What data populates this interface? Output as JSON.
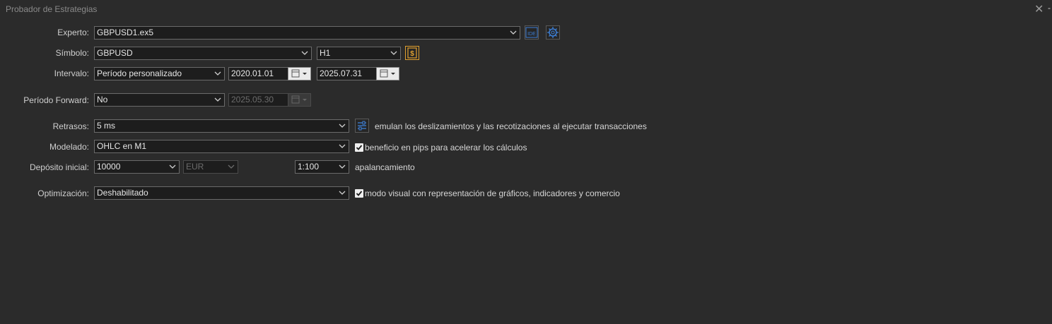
{
  "window": {
    "title": "Probador de Estrategias",
    "right_mark": "-"
  },
  "labels": {
    "experto": "Experto:",
    "simbolo": "Símbolo:",
    "intervalo": "Intervalo:",
    "periodo_forward": "Período Forward:",
    "retrasos": "Retrasos:",
    "modelado": "Modelado:",
    "deposito": "Depósito inicial:",
    "optimizacion": "Optimización:"
  },
  "fields": {
    "experto": "GBPUSD1.ex5",
    "simbolo": "GBPUSD",
    "timeframe": "H1",
    "intervalo": "Período personalizado",
    "fecha_inicio": "2020.01.01",
    "fecha_fin": "2025.07.31",
    "forward": "No",
    "fecha_forward": "2025.05.30",
    "retrasos": "5 ms",
    "modelado": "OHLC en M1",
    "deposito": "10000",
    "moneda": "EUR",
    "apalancamiento": "1:100",
    "optimizacion": "Deshabilitado"
  },
  "buttons": {
    "ide": "IDE"
  },
  "notes": {
    "retrasos": "emulan los deslizamientos y las recotizaciones al ejecutar transacciones",
    "modelado": "beneficio en pips para acelerar los cálculos",
    "apalancamiento": "apalancamiento",
    "optimizacion": "modo visual con representación de gráficos, indicadores y comercio"
  },
  "checkboxes": {
    "pips": true,
    "visual": true
  },
  "icons": {
    "close": "close-icon",
    "dropdown": "chevron-down-icon",
    "calendar": "calendar-icon",
    "ide": "ide-icon",
    "settings": "gear-icon",
    "dollar": "dollar-icon",
    "sliders": "sliders-icon"
  },
  "colors": {
    "accent": "#3d7fd6",
    "gold": "#e0a030",
    "background": "#2b2b2b"
  }
}
